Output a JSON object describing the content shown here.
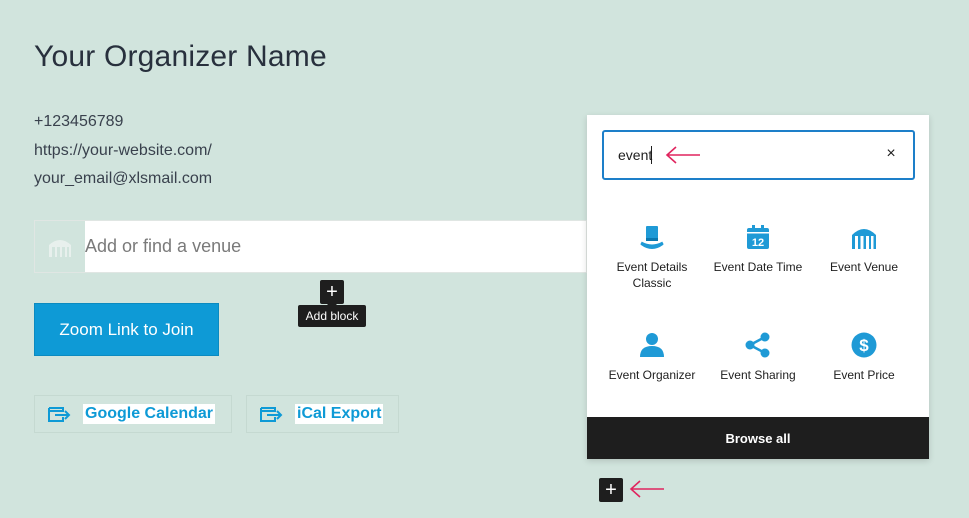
{
  "organizer": {
    "name": "Your Organizer Name",
    "phone": "+123456789",
    "website": "https://your-website.com/",
    "email": "your_email@xlsmail.com"
  },
  "venue": {
    "placeholder": "Add or find a venue",
    "icon": "venue-icon"
  },
  "add_block": {
    "plus_glyph": "+",
    "tooltip": "Add block"
  },
  "zoom_button": {
    "label": "Zoom Link to Join"
  },
  "calendar_links": [
    {
      "label": "Google Calendar",
      "icon": "calendar-export-icon"
    },
    {
      "label": "iCal Export",
      "icon": "calendar-export-icon"
    }
  ],
  "inserter": {
    "search_value": "event",
    "clear_glyph": "×",
    "blocks": [
      {
        "label": "Event Details Classic",
        "icon": "top-hat-icon"
      },
      {
        "label": "Event Date Time",
        "icon": "calendar-12-icon",
        "icon_text": "12"
      },
      {
        "label": "Event Venue",
        "icon": "venue-icon"
      },
      {
        "label": "Event Organizer",
        "icon": "person-icon"
      },
      {
        "label": "Event Sharing",
        "icon": "share-icon"
      },
      {
        "label": "Event Price",
        "icon": "dollar-icon",
        "icon_text": "$"
      }
    ],
    "browse_all": "Browse all"
  },
  "bottom_plus": {
    "glyph": "+"
  },
  "colors": {
    "background": "#d1e4dd",
    "accent": "#0e9ad6",
    "dark": "#1e1e1e",
    "arrow": "#e0245e",
    "search_border": "#1d7fc9"
  }
}
